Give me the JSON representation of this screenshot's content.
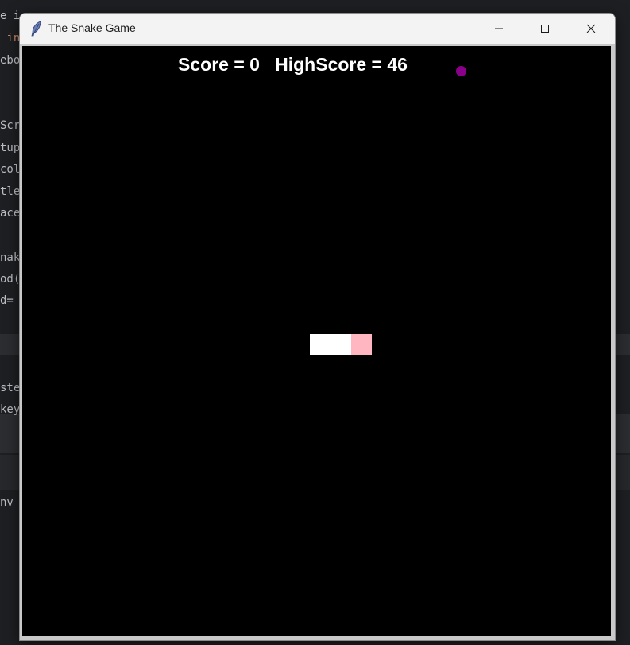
{
  "window": {
    "title": "The Snake Game"
  },
  "icons": {
    "app": "feather-icon",
    "minimize": "minimize-icon",
    "maximize": "maximize-icon",
    "close": "close-icon"
  },
  "game": {
    "score_label": "Score = 0   HighScore = 46",
    "score": 0,
    "high_score": 46,
    "colors": {
      "background": "#000000",
      "snake_body": "#ffffff",
      "snake_head": "#ffb6c1",
      "food": "#8b008b",
      "text": "#ffffff"
    }
  },
  "background_editor": {
    "lines": [
      "e i",
      " in",
      "ebo",
      "Scr",
      "tup",
      "col",
      "tle",
      "ace",
      "nak",
      "od(",
      "d= ",
      "ste",
      "key",
      "nv"
    ]
  }
}
